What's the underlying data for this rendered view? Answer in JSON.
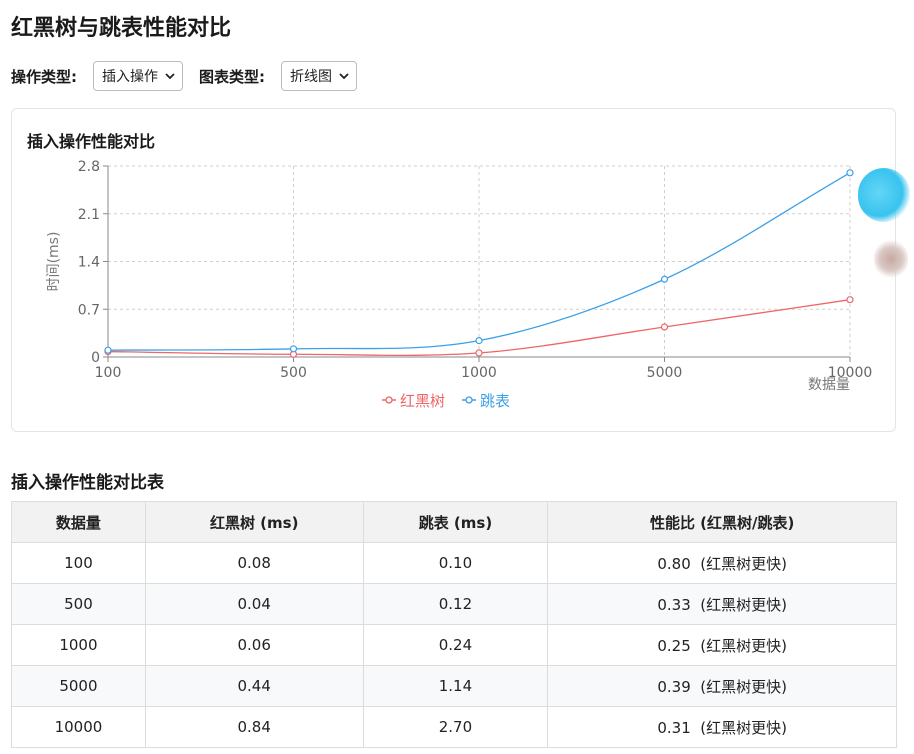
{
  "page": {
    "title": "红黑树与跳表性能对比"
  },
  "controls": {
    "operation_label": "操作类型:",
    "operation_value": "插入操作",
    "chart_type_label": "图表类型:",
    "chart_type_value": "折线图"
  },
  "chart": {
    "title": "插入操作性能对比"
  },
  "chart_data": {
    "type": "line",
    "title": "插入操作性能对比",
    "categories": [
      "100",
      "500",
      "1000",
      "5000",
      "10000"
    ],
    "xlabel": "数据量",
    "ylabel": "时间(ms)",
    "ylim": [
      0,
      2.8
    ],
    "yticks": [
      "0",
      "0.7",
      "1.4",
      "2.1",
      "2.8"
    ],
    "grid": true,
    "legend": "bottom",
    "series": [
      {
        "name": "红黑树",
        "color": "#ee6666",
        "values": [
          0.08,
          0.04,
          0.06,
          0.44,
          0.84
        ]
      },
      {
        "name": "跳表",
        "color": "#3ba0e8",
        "values": [
          0.1,
          0.12,
          0.24,
          1.14,
          2.7
        ]
      }
    ]
  },
  "table": {
    "title": "插入操作性能对比表",
    "headers": [
      "数据量",
      "红黑树 (ms)",
      "跳表 (ms)",
      "性能比 (红黑树/跳表)"
    ],
    "rows": [
      [
        "100",
        "0.08",
        "0.10",
        "0.80  (红黑树更快)"
      ],
      [
        "500",
        "0.04",
        "0.12",
        "0.33  (红黑树更快)"
      ],
      [
        "1000",
        "0.06",
        "0.24",
        "0.25  (红黑树更快)"
      ],
      [
        "5000",
        "0.44",
        "1.14",
        "0.39  (红黑树更快)"
      ],
      [
        "10000",
        "0.84",
        "2.70",
        "0.31  (红黑树更快)"
      ]
    ]
  }
}
